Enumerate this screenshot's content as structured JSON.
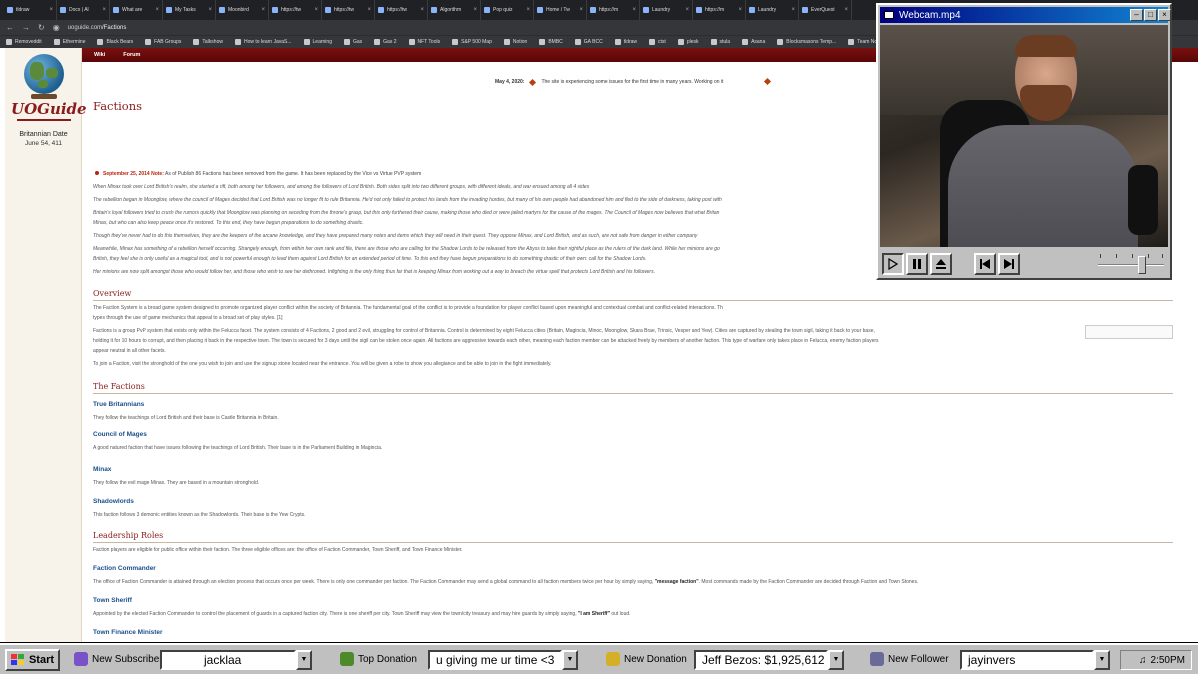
{
  "browser": {
    "tabs": [
      "tldraw",
      "Docs | Al",
      "What are",
      "My Tasks",
      "Moonbird",
      "https://tw",
      "https://tw",
      "https://tw",
      "Algorithm",
      "Pop quiz",
      "Home / Tw",
      "https://m",
      "Laundry",
      "https://m",
      "Laundry",
      "EverQuest"
    ],
    "url_host": "uoguide.com",
    "url_path": "/Factions",
    "bookmarks": [
      "Removeddit",
      "Ethermine",
      "Black Bears",
      "FAB Groups",
      "Talkshow",
      "How to learn JavaS...",
      "Learning",
      "Gas",
      "Gas 2",
      "NFT Tools",
      "S&P 500 Map",
      "Notion",
      "BMBC",
      "GA BCC",
      "tldraw",
      "ctst",
      "plesk",
      "stula",
      "Asana",
      "Blocksmasons Temp...",
      "Team Notion",
      "Skin-e"
    ]
  },
  "site": {
    "logo_text": "UOGuide",
    "date_label": "Britannian Date",
    "date_value": "June 54, 411",
    "nav": [
      "Wiki",
      "Forum"
    ],
    "notice_date": "May 4, 2020:",
    "notice_text": "The site is experiencing some issues for the first time in many years. Working on it"
  },
  "article": {
    "title": "Factions",
    "note_date": "September 25, 2014 Note:",
    "note_text": "As of Publish 86 Factions has been removed from the game. It has been replaced by the Vice vs Virtue PVP system",
    "intro": [
      "When Minax took over Lord British's realm, she started a rift, both among her followers, and among the followers of Lord British. Both sides split into two different groups, with different ideals, and war ensued among all 4 sides",
      "The rebellion began in Moonglow, where the council of Mages decided that Lord British was no longer fit to rule Britannia. He'd not only failed to protect his lands from the invading hordes, but many of his own people had abandoned him and fled to the side of darkness, taking post with",
      "Britain's loyal followers tried to crush the rumors quickly that Moonglow was planning on seceding from the throne's grasp, but this only furthered their cause, making those who died or were jailed martyrs for the cause of the mages. The Council of Mages now believes that what Britan",
      "Minax, but who can also keep peace once it's restored. To this end, they have begun preparations to do something drastic.",
      "Though they've never had to do this themselves, they are the keepers of the arcane knowledge, and they have prepared many notes and items which they will need in their quest. They oppose Minax, and Lord British, and as such, are not safe from danger in either company",
      "Meanwhile, Minax has something of a rebellion herself occurring. Strangely enough, from within her own rank and file, there are those who are calling for the Shadow Lords to be released from the Abyss to take their rightful place as the rulers of the dark land. While her minions are go",
      "British, they feel she is only useful as a magical tool, and is not powerful enough to lead them against Lord British for an extended period of time. To this end they have begun preparations to do something drastic of their own: call for the Shadow Lords.",
      "Her minions are now split amongst those who would follow her, and those who wish to see her dethroned. Infighting is the only thing thus far that is keeping Minax from working out a way to breach the virtue spell that protects Lord British and his followers."
    ],
    "overview_heading": "Overview",
    "overview": [
      "The Faction System is a broad game system designed to promote organized player conflict within the society of Britannia. The fundamental goal of the conflict is to provide a foundation for player conflict based upon meaningful and contextual combat and conflict-related interactions. Th",
      "types through the use of game mechanics that appeal to a broad set of play styles. [1]",
      "Factions is a group PvP system that exists only within the Felucca facet. The system consists of 4 Factions, 2 good and 2 evil, struggling for control of Britannia. Control is determined by eight Felucca cities (Britain, Magincia, Minoc, Moonglow, Skara Brae, Trinsic, Vesper and Yew). Cities are captured by stealing the town sigil, taking it back to your base,",
      "holding it for 10 hours to corrupt, and then placing it back in the respective town. The town is secured for 3 days until the sigil can be stolen once again. All factions are aggressive towards each other, meaning each faction member can be attacked freely by members of another faction. This type of warfare only takes place in Felucca, enemy faction players",
      "appear neutral in all other facets.",
      "To join a Faction, visit the stronghold of the one you wish to join and use the signup stone located near the entrance. You will be given a robe to show you allegiance and be able to join in the fight immediately."
    ],
    "factions_heading": "The Factions",
    "factions": [
      {
        "name": "True Britannians",
        "desc": "They follow the teachings of Lord British and their base is Castle Britannia in Britain."
      },
      {
        "name": "Council of Mages",
        "desc": "A good natured faction that have issues following the teachings of Lord British. Their base is in the Parliament Building in Magincia."
      },
      {
        "name": "Minax",
        "desc": "They follow the evil mage Minax. They are based in a mountain stronghold."
      },
      {
        "name": "Shadowlords",
        "desc": "This faction follows 3 demonic entities known as the Shadowlords. Their base is the Yew Crypts."
      }
    ],
    "leadership_heading": "Leadership Roles",
    "leadership_intro": "Faction players are eligible for public office within their faction. The three eligible offices are: the office of Faction Commander, Town Sheriff, and Town Finance Minister.",
    "roles": [
      {
        "name": "Faction Commander",
        "desc": "The office of Faction Commander is attained through an election process that occurs once per week. There is only one commander per faction. The Faction Commander may send a global command to all faction members twice per hour by simply saying, ",
        "cmd": "\"message faction\"",
        "after": ". Most commands made by the Faction Commander are decided through Faction and Town Stones."
      },
      {
        "name": "Town Sheriff",
        "desc": "Appointed by the elected Faction Commander to control the placement of guards in a captured faction city. There is one sheriff per city. Town Sheriff may view the town/city treasury and may hire guards by simply saying, ",
        "cmd": "\"I am Sheriff\"",
        "after": " out loud."
      },
      {
        "name": "Town Finance Minister",
        "desc": "Appointed by the Faction Commander to manage taxes and resource vendors in a captured city. There is one finance minister per city. The Finance Minister may access the town/city treasury to change tax rates and may hire vendors by simply saying, ",
        "cmd": "\"I wish to access the city treasury\"",
        "after": ""
      }
    ],
    "items_heading": "Items",
    "items_text": "Starting with Publish 56, players can now use silver to purchase special items and equipment. These items are only usable by faction players. Worn equipment requires a certain level rank to use. Inside each stronghold near the faction stone is a Cooperative Collection chest. Donate silver to it and collect rewards. In the future, silver donated to the faction in this way will be beneficial to the"
  },
  "webcam": {
    "title": "Webcam.mp4"
  },
  "taskbar": {
    "start_label": "Start",
    "widgets": [
      {
        "label": "New Subscriber",
        "value": "jacklaa"
      },
      {
        "label": "Top Donation",
        "value": "u giving me ur time <3"
      },
      {
        "label": "New Donation",
        "value": "Jeff Bezos: $1,925,612"
      },
      {
        "label": "New Follower",
        "value": "jayinvers"
      }
    ],
    "clock": "2:50PM"
  }
}
